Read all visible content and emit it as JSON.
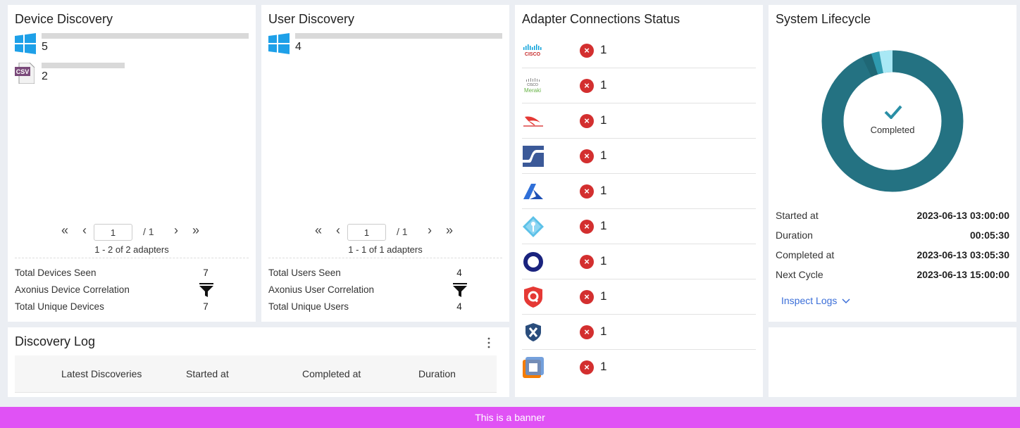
{
  "device_discovery": {
    "title": "Device Discovery",
    "adapters": [
      {
        "icon": "windows-icon",
        "count": "5",
        "fraction": 1.0
      },
      {
        "icon": "csv-icon",
        "count": "2",
        "fraction": 0.4
      }
    ],
    "pager": {
      "first": "«",
      "prev": "‹",
      "page": "1",
      "total": "/ 1",
      "next": "›",
      "last": "»"
    },
    "range_text": "1 - 2 of 2 adapters",
    "stats": [
      {
        "label": "Total Devices Seen",
        "value": "7"
      },
      {
        "label": "Axonius Device Correlation",
        "value": ""
      },
      {
        "label": "Total Unique Devices",
        "value": "7"
      }
    ]
  },
  "user_discovery": {
    "title": "User Discovery",
    "adapters": [
      {
        "icon": "windows-icon",
        "count": "4",
        "fraction": 1.0
      }
    ],
    "pager": {
      "first": "«",
      "prev": "‹",
      "page": "1",
      "total": "/ 1",
      "next": "›",
      "last": "»"
    },
    "range_text": "1 - 1 of 1 adapters",
    "stats": [
      {
        "label": "Total Users Seen",
        "value": "4"
      },
      {
        "label": "Axonius User Correlation",
        "value": ""
      },
      {
        "label": "Total Unique Users",
        "value": "4"
      }
    ]
  },
  "adapter_status": {
    "title": "Adapter Connections Status",
    "rows": [
      {
        "logo": "cisco-logo",
        "error_count": "1"
      },
      {
        "logo": "cisco-meraki-logo",
        "error_count": "1"
      },
      {
        "logo": "crowdstrike-logo",
        "error_count": "1"
      },
      {
        "logo": "blue-square-logo",
        "error_count": "1"
      },
      {
        "logo": "azure-logo",
        "error_count": "1"
      },
      {
        "logo": "diamond-key-logo",
        "error_count": "1"
      },
      {
        "logo": "okta-logo",
        "error_count": "1"
      },
      {
        "logo": "qualys-logo",
        "error_count": "1"
      },
      {
        "logo": "shield-x-logo",
        "error_count": "1"
      },
      {
        "logo": "orange-square-logo",
        "error_count": "1"
      }
    ],
    "error_glyph": "×"
  },
  "system_lifecycle": {
    "title": "System Lifecycle",
    "status": "Completed",
    "rows": [
      {
        "label": "Started at",
        "value": "2023-06-13 03:00:00"
      },
      {
        "label": "Duration",
        "value": "00:05:30"
      },
      {
        "label": "Completed at",
        "value": "2023-06-13 03:05:30"
      },
      {
        "label": "Next Cycle",
        "value": "2023-06-13 15:00:00"
      }
    ],
    "inspect_label": "Inspect Logs",
    "colors": {
      "main": "#247282",
      "dark": "#1f6775",
      "mid": "#2f9bb0",
      "light": "#a9e8f5"
    }
  },
  "discovery_log": {
    "title": "Discovery Log",
    "columns": [
      "Latest Discoveries",
      "Started at",
      "Completed at",
      "Duration"
    ]
  },
  "banner": {
    "text": "This is a banner"
  }
}
